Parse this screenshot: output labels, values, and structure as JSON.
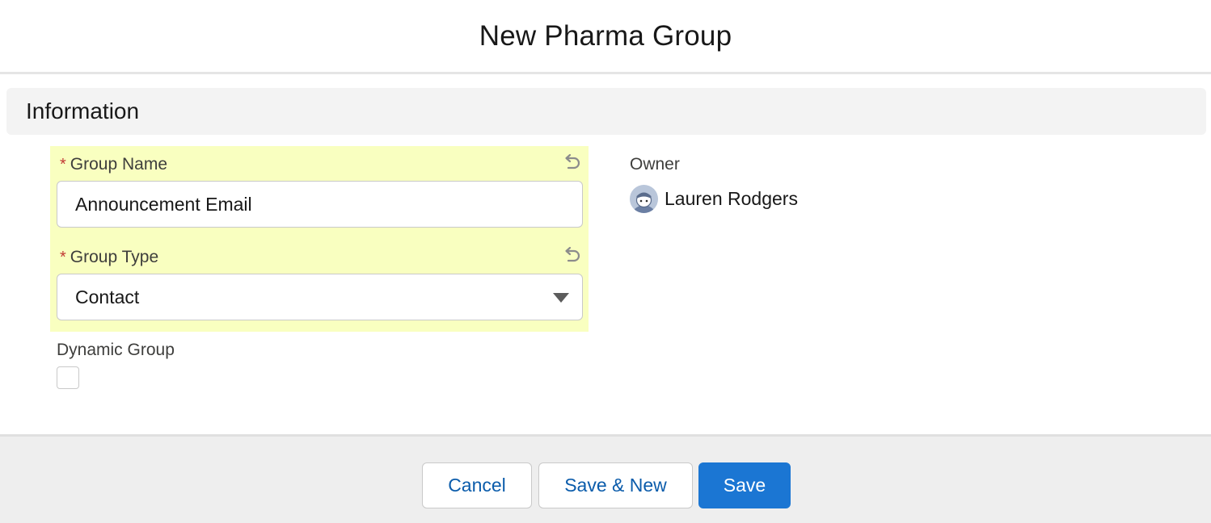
{
  "modal": {
    "title": "New Pharma Group"
  },
  "section": {
    "title": "Information"
  },
  "fields": {
    "group_name": {
      "label": "Group Name",
      "required_marker": "*",
      "value": "Announcement Email"
    },
    "group_type": {
      "label": "Group Type",
      "required_marker": "*",
      "value": "Contact"
    },
    "dynamic_group": {
      "label": "Dynamic Group",
      "checked": false
    },
    "owner": {
      "label": "Owner",
      "name": "Lauren Rodgers"
    }
  },
  "icons": {
    "undo": "undo-icon",
    "dropdown": "chevron-down-icon",
    "avatar": "avatar-icon"
  },
  "footer": {
    "cancel_label": "Cancel",
    "save_new_label": "Save & New",
    "save_label": "Save"
  },
  "colors": {
    "brand": "#1b76d3",
    "highlight": "#f9ffc0",
    "required": "#c23934",
    "link_text": "#0b5cab"
  }
}
